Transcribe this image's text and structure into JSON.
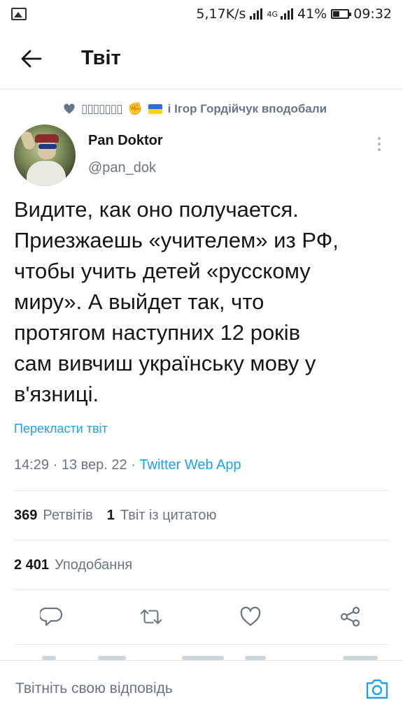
{
  "status_bar": {
    "speed": "5,17K/s",
    "network": "4G",
    "battery": "41%",
    "time": "09:32"
  },
  "header": {
    "title": "Твіт"
  },
  "tweet": {
    "liked_by_boxes": "▯▯▯▯▯▯▯",
    "liked_by_text": "і Ігор Гордійчук вподобали",
    "author_name": "Pan Doktor",
    "author_handle": "@pan_dok",
    "text": "Видите, как оно получается.\nПриезжаешь «учителем» из РФ,\nчтобы учить детей «русскому\nмиру». А выйдет так, что\nпротягом наступних 12 років\nсам вивчиш українську мову у\nв'язниці.",
    "translate_label": "Перекласти твіт",
    "timestamp": "14:29 · 13 вер. 22 · ",
    "source": "Twitter Web App",
    "retweets_count": "369",
    "retweets_label": "Ретвітів",
    "quotes_count": "1",
    "quotes_label": "Твіт із цитатою",
    "likes_count": "2 401",
    "likes_label": "Уподобання"
  },
  "reply": {
    "placeholder": "Твітніть свою відповідь"
  },
  "icons": {
    "back": "arrow-left-icon",
    "reply": "reply-icon",
    "retweet": "retweet-icon",
    "like": "heart-icon",
    "share": "share-icon",
    "camera": "camera-icon"
  },
  "colors": {
    "accent": "#1da1f2",
    "secondary_text": "#657786",
    "divider": "#e1e8ed"
  }
}
